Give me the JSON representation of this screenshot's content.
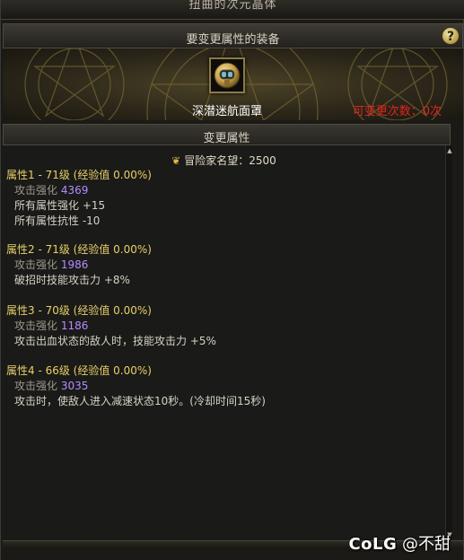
{
  "window": {
    "title": "扭曲的次元晶体"
  },
  "equipment": {
    "header": "要变更属性的装备",
    "help_label": "?",
    "item_name": "深潜迷航面罩",
    "change_count": "可变更次数：0次"
  },
  "section": {
    "header": "变更属性"
  },
  "fame": {
    "icon": "fame-crest-icon",
    "text": "冒险家名望：2500"
  },
  "attributes": [
    {
      "title": "属性1 - 71级 (经验值 0.00%)",
      "stat_label": "攻击强化",
      "stat_value": "4369",
      "effects": [
        "所有属性强化 +15",
        "所有属性抗性 -10"
      ]
    },
    {
      "title": "属性2 - 71级 (经验值 0.00%)",
      "stat_label": "攻击强化",
      "stat_value": "1986",
      "effects": [
        "破招时技能攻击力 +8%"
      ]
    },
    {
      "title": "属性3 - 70级 (经验值 0.00%)",
      "stat_label": "攻击强化",
      "stat_value": "1186",
      "effects": [
        "攻击出血状态的敌人时，技能攻击力 +5%"
      ]
    },
    {
      "title": "属性4 - 66级 (经验值 0.00%)",
      "stat_label": "攻击强化",
      "stat_value": "3035",
      "effects": [
        "攻击时，使敌人进入减速状态10秒。(冷却时间15秒)"
      ]
    }
  ],
  "watermark": {
    "brand": "CoLG",
    "handle": "@不甜"
  },
  "colors": {
    "attr_title": "#e8cf6a",
    "stat_value": "#b48cff",
    "change_count": "#e0241e"
  }
}
